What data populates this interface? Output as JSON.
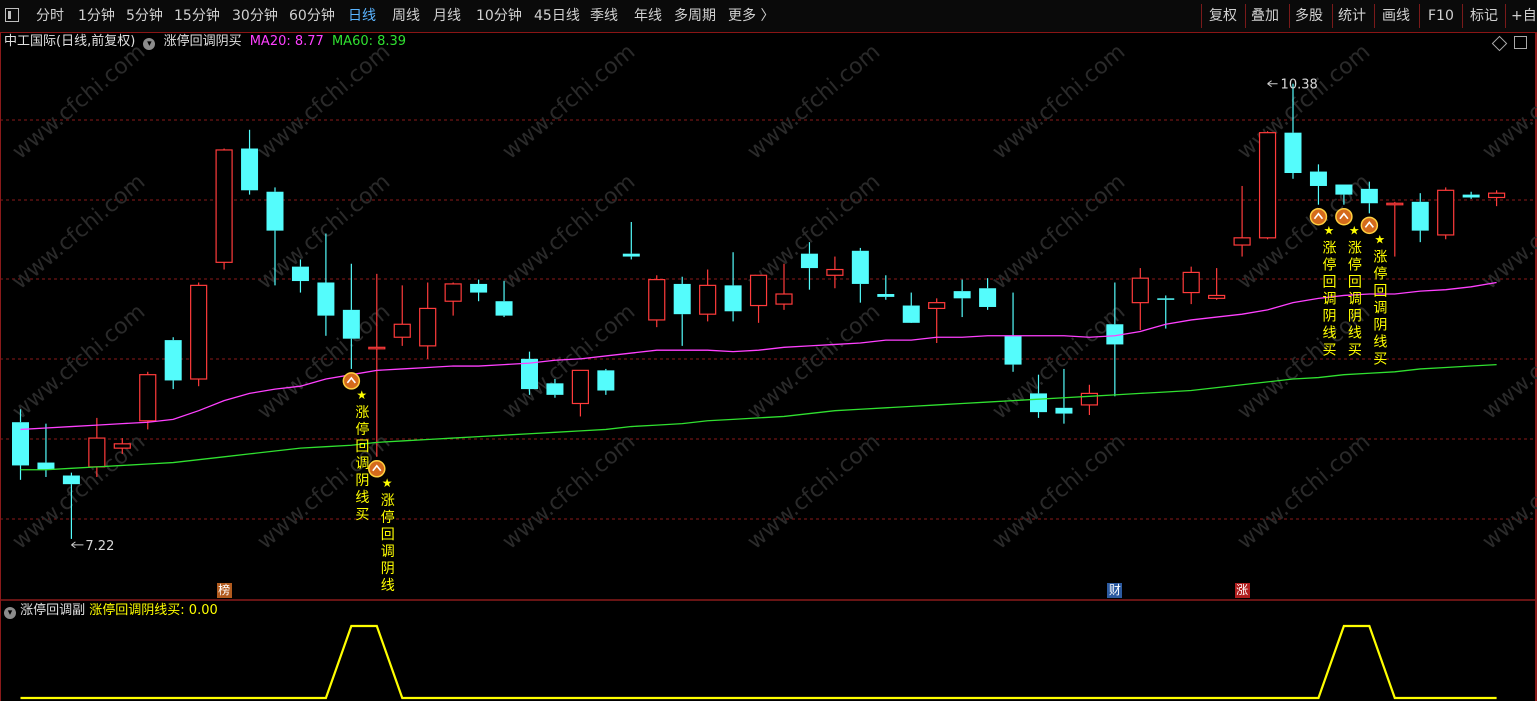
{
  "toolbar": {
    "periods": [
      "分时",
      "1分钟",
      "5分钟",
      "15分钟",
      "30分钟",
      "60分钟",
      "日线",
      "周线",
      "月线",
      "10分钟",
      "45日线",
      "季线",
      "年线",
      "多周期",
      "更多 〉"
    ],
    "active_period": "日线",
    "right_buttons": [
      "复权",
      "叠加",
      "多股",
      "统计",
      "画线",
      "F10",
      "标记",
      "+自"
    ]
  },
  "main_legend": {
    "stock": "中工国际(日线,前复权)",
    "indicator": "涨停回调阴买",
    "ma20_label": "MA20: 8.77",
    "ma60_label": "MA60: 8.39"
  },
  "sub_legend": {
    "indicator": "涨停回调副",
    "value_label": "涨停回调阴线买: 0.00"
  },
  "badges": [
    {
      "char": "榜",
      "candle": 8,
      "color": "#b05a1e"
    },
    {
      "char": "财",
      "candle": 43,
      "color": "#2c5aa0"
    },
    {
      "char": "涨",
      "candle": 48,
      "color": "#b01e1e"
    }
  ],
  "watermark": "www.cfchi.com",
  "colors": {
    "up": "#ff3b3b",
    "down": "#54fcfc",
    "ma20": "#ff40ff",
    "ma60": "#30e030",
    "signal": "#ffff00",
    "grid": "#8a1a1a"
  },
  "chart_data": {
    "type": "candlestick",
    "price_range": [
      6.9,
      10.6
    ],
    "high_label": "10.38",
    "low_label": "7.22",
    "high_candle": 49,
    "low_candle": 2,
    "candles": [
      {
        "o": 8.03,
        "h": 8.12,
        "l": 7.63,
        "c": 7.73
      },
      {
        "o": 7.75,
        "h": 8.02,
        "l": 7.65,
        "c": 7.7
      },
      {
        "o": 7.66,
        "h": 7.68,
        "l": 7.22,
        "c": 7.6
      },
      {
        "o": 7.72,
        "h": 8.06,
        "l": 7.65,
        "c": 7.92
      },
      {
        "o": 7.85,
        "h": 7.92,
        "l": 7.81,
        "c": 7.88
      },
      {
        "o": 8.04,
        "h": 8.38,
        "l": 7.98,
        "c": 8.36
      },
      {
        "o": 8.6,
        "h": 8.62,
        "l": 8.26,
        "c": 8.32
      },
      {
        "o": 8.33,
        "h": 9.0,
        "l": 8.28,
        "c": 8.98
      },
      {
        "o": 9.14,
        "h": 9.93,
        "l": 9.09,
        "c": 9.92
      },
      {
        "o": 9.93,
        "h": 10.06,
        "l": 9.61,
        "c": 9.64
      },
      {
        "o": 9.63,
        "h": 9.66,
        "l": 8.98,
        "c": 9.36
      },
      {
        "o": 9.11,
        "h": 9.16,
        "l": 8.93,
        "c": 9.01
      },
      {
        "o": 9.0,
        "h": 9.34,
        "l": 8.63,
        "c": 8.77
      },
      {
        "o": 8.81,
        "h": 9.13,
        "l": 8.4,
        "c": 8.61
      },
      {
        "o": 8.54,
        "h": 9.06,
        "l": 7.79,
        "c": 8.55
      },
      {
        "o": 8.62,
        "h": 8.98,
        "l": 8.56,
        "c": 8.71
      },
      {
        "o": 8.56,
        "h": 9.0,
        "l": 8.47,
        "c": 8.82
      },
      {
        "o": 8.87,
        "h": 9.0,
        "l": 8.77,
        "c": 8.99
      },
      {
        "o": 8.99,
        "h": 9.02,
        "l": 8.87,
        "c": 8.93
      },
      {
        "o": 8.87,
        "h": 9.01,
        "l": 8.76,
        "c": 8.77
      },
      {
        "o": 8.47,
        "h": 8.52,
        "l": 8.22,
        "c": 8.26
      },
      {
        "o": 8.3,
        "h": 8.33,
        "l": 8.2,
        "c": 8.22
      },
      {
        "o": 8.16,
        "h": 8.39,
        "l": 8.07,
        "c": 8.39
      },
      {
        "o": 8.39,
        "h": 8.4,
        "l": 8.22,
        "c": 8.25
      },
      {
        "o": 9.2,
        "h": 9.42,
        "l": 9.16,
        "c": 9.18
      },
      {
        "o": 8.74,
        "h": 9.05,
        "l": 8.69,
        "c": 9.02
      },
      {
        "o": 8.99,
        "h": 9.04,
        "l": 8.56,
        "c": 8.78
      },
      {
        "o": 8.78,
        "h": 9.09,
        "l": 8.73,
        "c": 8.98
      },
      {
        "o": 8.98,
        "h": 9.21,
        "l": 8.73,
        "c": 8.8
      },
      {
        "o": 8.84,
        "h": 9.04,
        "l": 8.72,
        "c": 9.05
      },
      {
        "o": 8.85,
        "h": 9.13,
        "l": 8.81,
        "c": 8.92
      },
      {
        "o": 9.2,
        "h": 9.28,
        "l": 8.95,
        "c": 9.1
      },
      {
        "o": 9.05,
        "h": 9.18,
        "l": 8.96,
        "c": 9.09
      },
      {
        "o": 9.22,
        "h": 9.24,
        "l": 8.86,
        "c": 8.99
      },
      {
        "o": 8.92,
        "h": 9.05,
        "l": 8.88,
        "c": 8.9
      },
      {
        "o": 8.84,
        "h": 8.93,
        "l": 8.73,
        "c": 8.72
      },
      {
        "o": 8.82,
        "h": 8.89,
        "l": 8.58,
        "c": 8.86
      },
      {
        "o": 8.94,
        "h": 9.02,
        "l": 8.76,
        "c": 8.89
      },
      {
        "o": 8.96,
        "h": 9.03,
        "l": 8.81,
        "c": 8.83
      },
      {
        "o": 8.63,
        "h": 8.93,
        "l": 8.38,
        "c": 8.43
      },
      {
        "o": 8.23,
        "h": 8.36,
        "l": 8.06,
        "c": 8.1
      },
      {
        "o": 8.13,
        "h": 8.4,
        "l": 8.02,
        "c": 8.09
      },
      {
        "o": 8.15,
        "h": 8.29,
        "l": 8.08,
        "c": 8.23
      },
      {
        "o": 8.71,
        "h": 9.0,
        "l": 8.21,
        "c": 8.57
      },
      {
        "o": 8.86,
        "h": 9.1,
        "l": 8.67,
        "c": 9.03
      },
      {
        "o": 8.89,
        "h": 8.91,
        "l": 8.68,
        "c": 8.88
      },
      {
        "o": 8.93,
        "h": 9.11,
        "l": 8.85,
        "c": 9.07
      },
      {
        "o": 8.89,
        "h": 9.1,
        "l": 8.88,
        "c": 8.91
      },
      {
        "o": 9.26,
        "h": 9.67,
        "l": 9.18,
        "c": 9.31
      },
      {
        "o": 9.31,
        "h": 10.05,
        "l": 9.3,
        "c": 10.04
      },
      {
        "o": 10.04,
        "h": 10.38,
        "l": 9.72,
        "c": 9.76
      },
      {
        "o": 9.77,
        "h": 9.82,
        "l": 9.54,
        "c": 9.67
      },
      {
        "o": 9.68,
        "h": 9.68,
        "l": 9.54,
        "c": 9.61
      },
      {
        "o": 9.65,
        "h": 9.7,
        "l": 9.48,
        "c": 9.55
      },
      {
        "o": 9.54,
        "h": 9.56,
        "l": 9.18,
        "c": 9.55
      },
      {
        "o": 9.56,
        "h": 9.62,
        "l": 9.28,
        "c": 9.36
      },
      {
        "o": 9.33,
        "h": 9.66,
        "l": 9.3,
        "c": 9.64
      },
      {
        "o": 9.61,
        "h": 9.63,
        "l": 9.58,
        "c": 9.59
      },
      {
        "o": 9.59,
        "h": 9.64,
        "l": 9.53,
        "c": 9.62
      }
    ],
    "ma20": [
      7.98,
      7.99,
      8.0,
      8.01,
      8.02,
      8.03,
      8.05,
      8.11,
      8.18,
      8.23,
      8.26,
      8.28,
      8.33,
      8.36,
      8.39,
      8.4,
      8.41,
      8.42,
      8.42,
      8.43,
      8.44,
      8.46,
      8.47,
      8.49,
      8.51,
      8.53,
      8.53,
      8.53,
      8.52,
      8.53,
      8.55,
      8.56,
      8.57,
      8.58,
      8.6,
      8.6,
      8.62,
      8.62,
      8.63,
      8.63,
      8.63,
      8.63,
      8.62,
      8.63,
      8.66,
      8.71,
      8.74,
      8.76,
      8.78,
      8.81,
      8.86,
      8.89,
      8.91,
      8.92,
      8.92,
      8.94,
      8.95,
      8.97,
      9.0
    ],
    "ma60": [
      7.7,
      7.7,
      7.71,
      7.72,
      7.73,
      7.74,
      7.75,
      7.77,
      7.79,
      7.81,
      7.83,
      7.85,
      7.86,
      7.87,
      7.89,
      7.9,
      7.91,
      7.92,
      7.93,
      7.94,
      7.95,
      7.96,
      7.97,
      7.98,
      8.0,
      8.01,
      8.02,
      8.04,
      8.05,
      8.06,
      8.07,
      8.09,
      8.11,
      8.12,
      8.13,
      8.14,
      8.15,
      8.16,
      8.17,
      8.18,
      8.19,
      8.2,
      8.21,
      8.22,
      8.23,
      8.24,
      8.25,
      8.27,
      8.29,
      8.31,
      8.33,
      8.34,
      8.36,
      8.37,
      8.38,
      8.4,
      8.41,
      8.42,
      8.43
    ],
    "signal_candles": [
      13,
      14,
      52,
      53,
      54
    ],
    "signal_label": "涨停回调阴线买",
    "sub_chart": {
      "title": "涨停回调副",
      "series": [
        {
          "name": "涨停回调阴线买",
          "values": [
            0,
            0,
            0,
            0,
            0,
            0,
            0,
            0,
            0,
            0,
            0,
            0,
            0,
            1,
            1,
            0,
            0,
            0,
            0,
            0,
            0,
            0,
            0,
            0,
            0,
            0,
            0,
            0,
            0,
            0,
            0,
            0,
            0,
            0,
            0,
            0,
            0,
            0,
            0,
            0,
            0,
            0,
            0,
            0,
            0,
            0,
            0,
            0,
            0,
            0,
            0,
            0,
            1,
            1,
            0,
            0,
            0,
            0,
            0
          ]
        }
      ],
      "ylim": [
        0,
        1
      ]
    }
  }
}
